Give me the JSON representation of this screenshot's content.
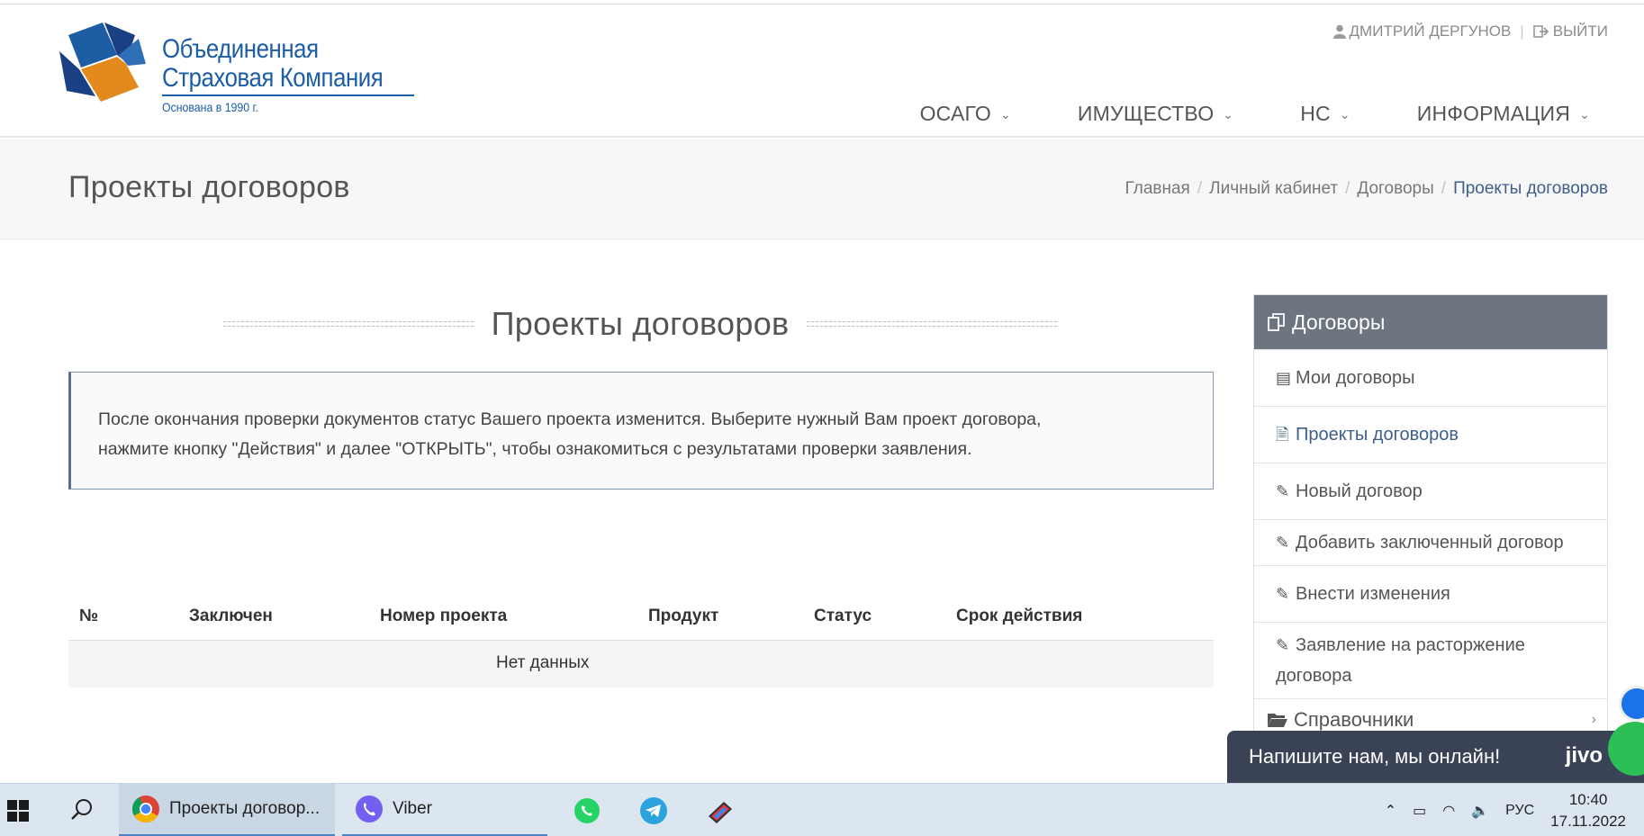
{
  "header": {
    "logo": {
      "line1": "Объединенная",
      "line2": "Страховая Компания",
      "sub": "Основана в 1990 г.",
      "colors": {
        "blue": "#1d5da4",
        "orange": "#e28a1e",
        "navy": "#1b3f83"
      }
    },
    "user": {
      "name": "ДМИТРИЙ ДЕРГУНОВ",
      "logout": "ВЫЙТИ"
    },
    "nav": [
      {
        "label": "ОСАГО"
      },
      {
        "label": "ИМУЩЕСТВО"
      },
      {
        "label": "НС"
      },
      {
        "label": "ИНФОРМАЦИЯ"
      }
    ]
  },
  "band": {
    "title": "Проекты договоров",
    "breadcrumb": [
      "Главная",
      "Личный кабинет",
      "Договоры",
      "Проекты договоров"
    ]
  },
  "main": {
    "section_title": "Проекты договоров",
    "notice_line1": "После окончания проверки документов статус Вашего проекта изменится. Выберите нужный Вам проект договора,",
    "notice_line2": "нажмите кнопку \"Действия\" и далее \"ОТКРЫТЬ\", чтобы ознакомиться с результатами проверки заявления.",
    "table": {
      "columns": [
        "№",
        "Заключен",
        "Номер проекта",
        "Продукт",
        "Статус",
        "Срок действия"
      ],
      "empty": "Нет данных"
    }
  },
  "sidebar": {
    "title": "Договоры",
    "items": [
      {
        "label": "Мои договоры"
      },
      {
        "label": "Проекты договоров"
      },
      {
        "label": "Новый договор"
      },
      {
        "label": "Добавить заключенный договор"
      },
      {
        "label": "Внести изменения"
      },
      {
        "label": "Заявление на расторжение договора"
      }
    ],
    "more": "Справочники"
  },
  "jivo": {
    "text": "Напишите нам, мы онлайн!",
    "brand": "jivo"
  },
  "taskbar": {
    "chrome_label": "Проекты договор...",
    "viber_label": "Viber",
    "lang": "РУС",
    "time": "10:40",
    "date": "17.11.2022"
  }
}
